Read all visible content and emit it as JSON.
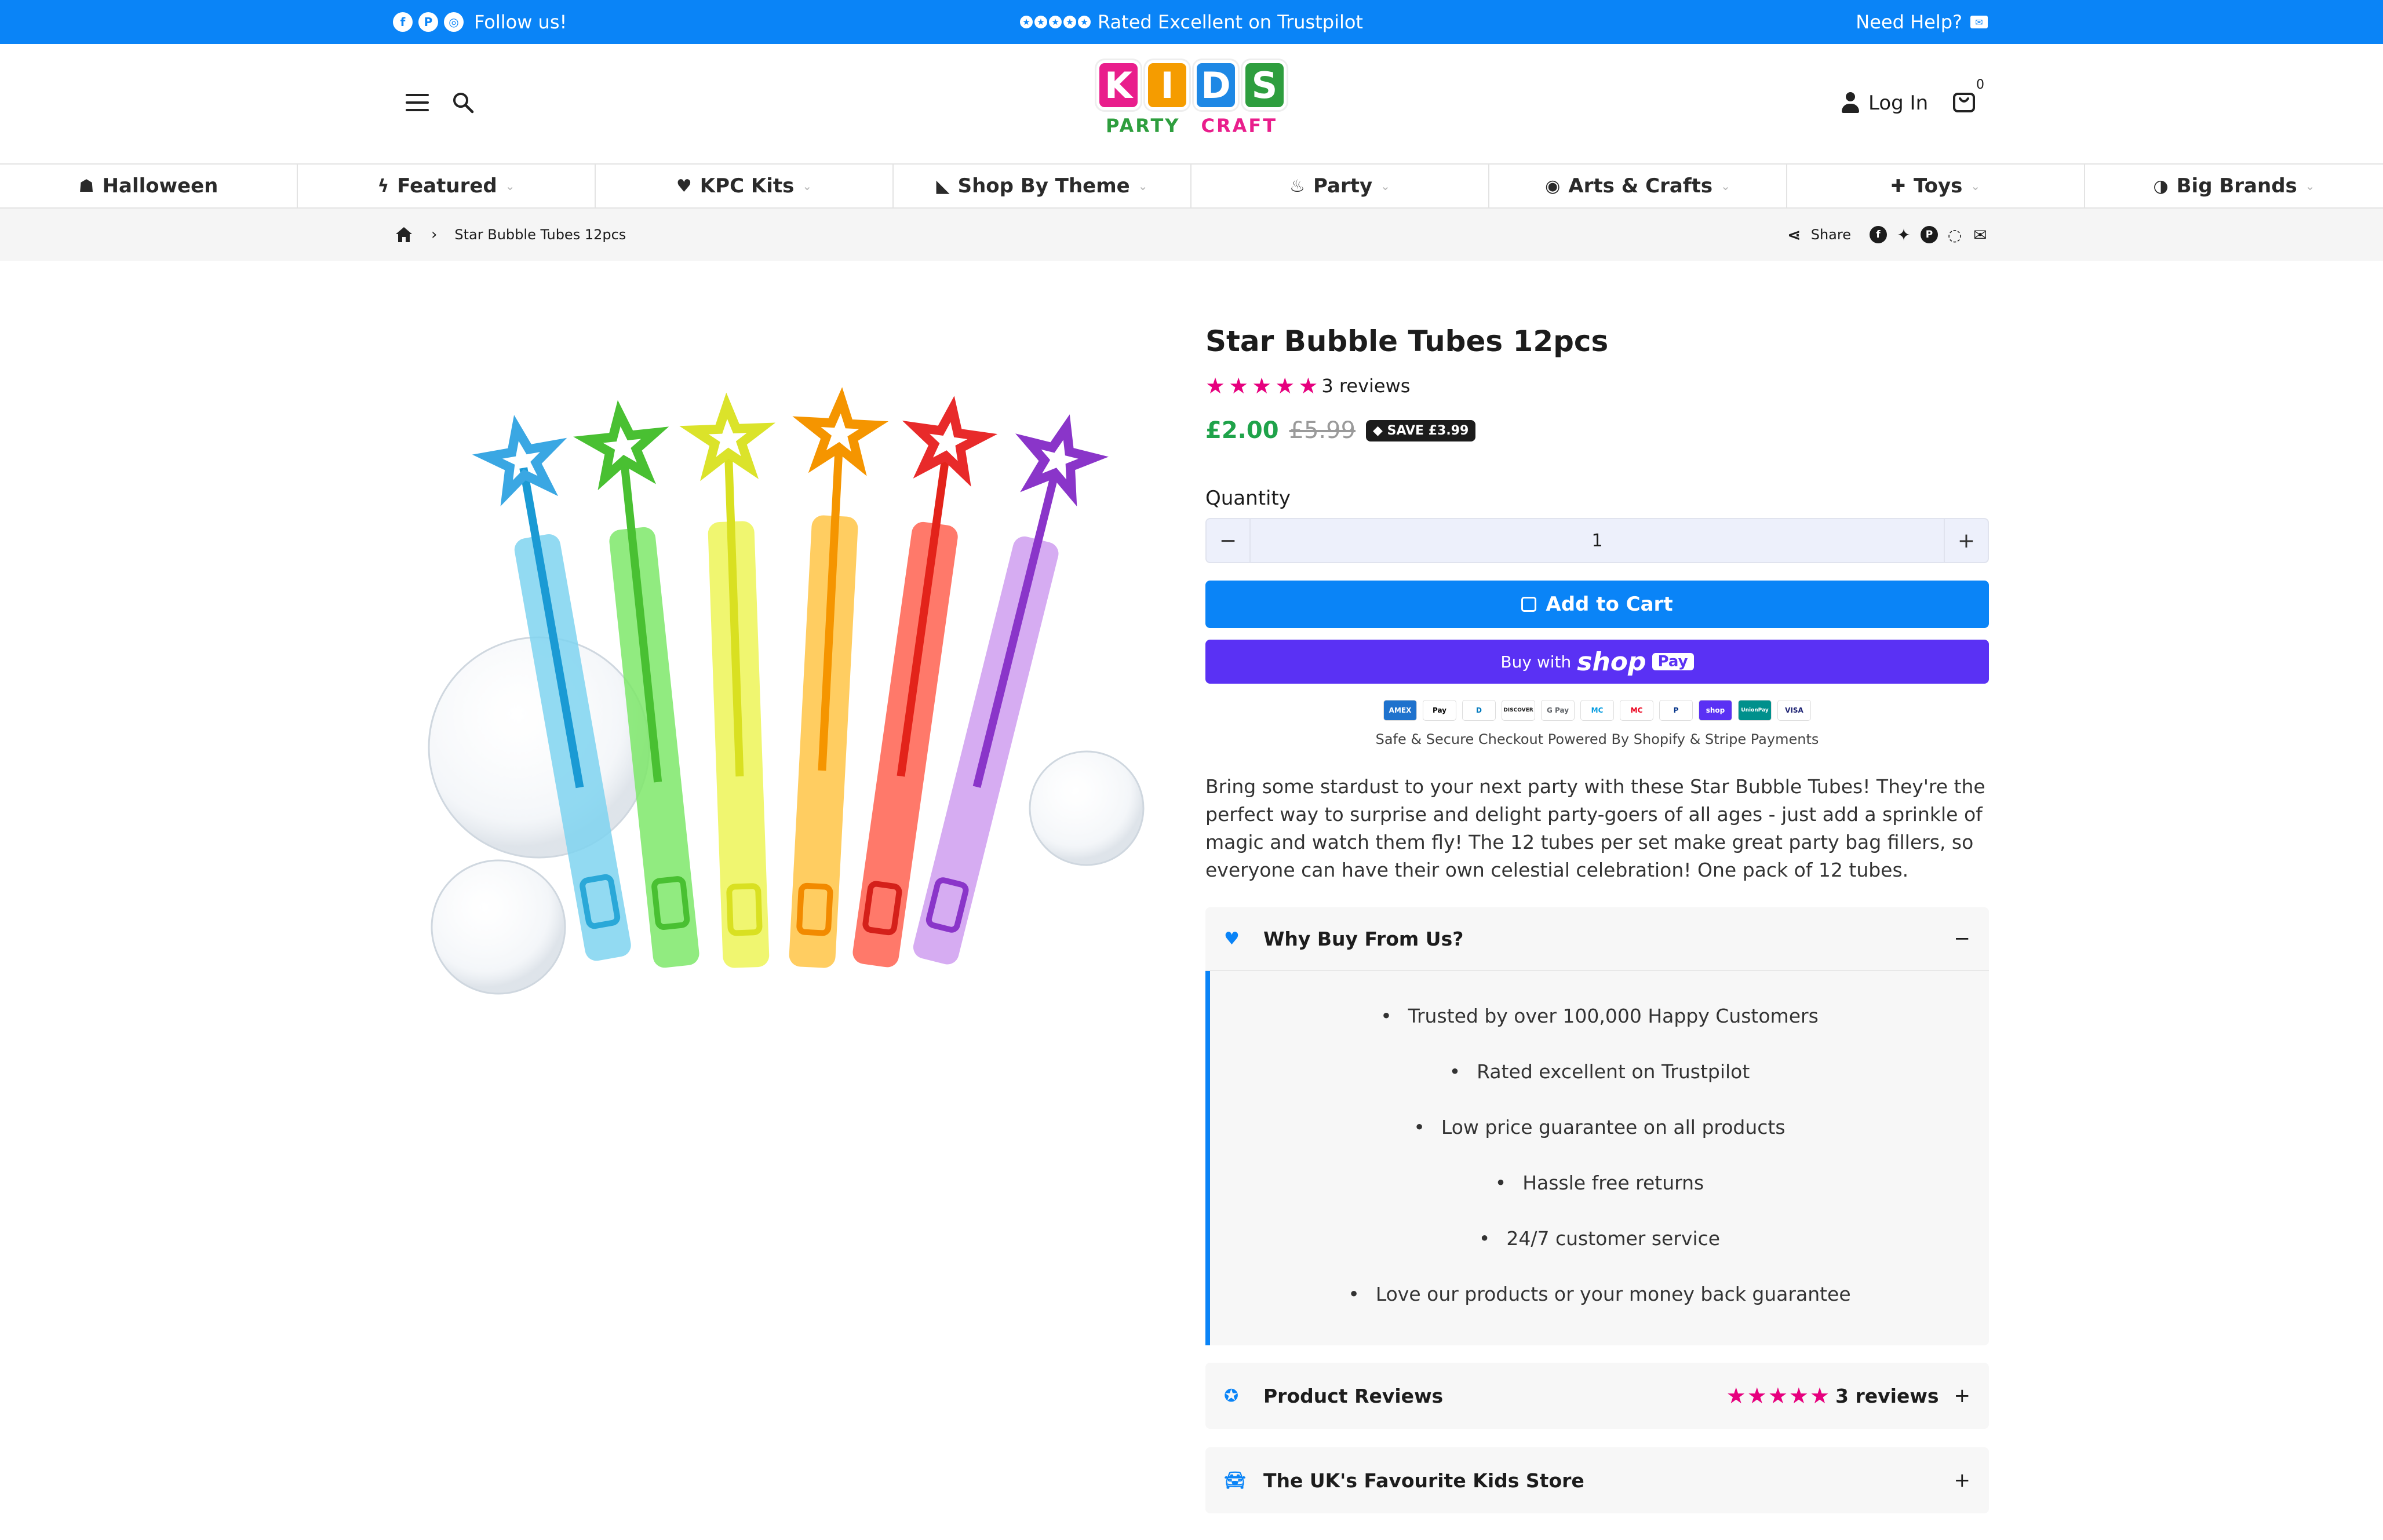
{
  "topbar": {
    "follow_text": "Follow us!",
    "trustpilot_text": "Rated Excellent on Trustpilot",
    "help_text": "Need Help?"
  },
  "header": {
    "logo": {
      "letters": [
        "K",
        "I",
        "D",
        "S"
      ],
      "sub_left": "PARTY",
      "sub_right": "CRAFT"
    },
    "login_label": "Log In",
    "cart_count": "0"
  },
  "nav": {
    "items": [
      {
        "label": "Halloween",
        "icon": "ghost-icon"
      },
      {
        "label": "Featured",
        "icon": "lightning-icon"
      },
      {
        "label": "KPC Kits",
        "icon": "heart-icon"
      },
      {
        "label": "Shop By Theme",
        "icon": "dinosaur-icon"
      },
      {
        "label": "Party",
        "icon": "cake-icon"
      },
      {
        "label": "Arts & Crafts",
        "icon": "palette-icon"
      },
      {
        "label": "Toys",
        "icon": "puzzle-icon"
      },
      {
        "label": "Big Brands",
        "icon": "brand-icon"
      }
    ]
  },
  "breadcrumb": {
    "current": "Star Bubble Tubes 12pcs",
    "share_label": "Share"
  },
  "product": {
    "title": "Star Bubble Tubes 12pcs",
    "rating": 5,
    "reviews_text": "3 reviews",
    "price": "£2.00",
    "old_price": "£5.99",
    "save_text": "SAVE £3.99",
    "quantity_label": "Quantity",
    "quantity_value": "1",
    "add_to_cart_label": "Add to Cart",
    "buy_with_label": "Buy with",
    "shop_word": "shop",
    "pay_word": "Pay",
    "payment_icons": [
      "AMEX",
      "Pay",
      "D",
      "DISCOVER",
      "G Pay",
      "MC",
      "MC",
      "P",
      "shop",
      "UnionPay",
      "VISA"
    ],
    "secure_text": "Safe & Secure Checkout Powered By Shopify & Stripe Payments",
    "description": "Bring some stardust to your next party with these Star Bubble Tubes! They're the perfect way to surprise and delight party-goers of all ages - just add a sprinkle of magic and watch them fly! The 12 tubes per set make great party bag fillers, so everyone can have their own celestial celebration! One pack of 12 tubes."
  },
  "accordions": {
    "why_buy": {
      "title": "Why Buy From Us?",
      "toggle": "−",
      "items": [
        "Trusted by over 100,000 Happy Customers",
        "Rated excellent on Trustpilot",
        "Low price guarantee on all products",
        "Hassle free returns",
        "24/7 customer service",
        "Love our products or your money back guarantee"
      ]
    },
    "reviews": {
      "title": "Product Reviews",
      "reviews_text": "3 reviews",
      "toggle": "+"
    },
    "store": {
      "title": "The UK's Favourite Kids Store",
      "toggle": "+"
    }
  },
  "colors": {
    "brand_blue": "#0a84f7",
    "star_pink": "#e6007e",
    "price_green": "#1fa34a",
    "shop_pay_purple": "#5a31f4",
    "logo_pink": "#e91e8c",
    "logo_orange": "#f59c00",
    "logo_blue": "#1e88e5",
    "logo_green": "#2e9e3e"
  }
}
